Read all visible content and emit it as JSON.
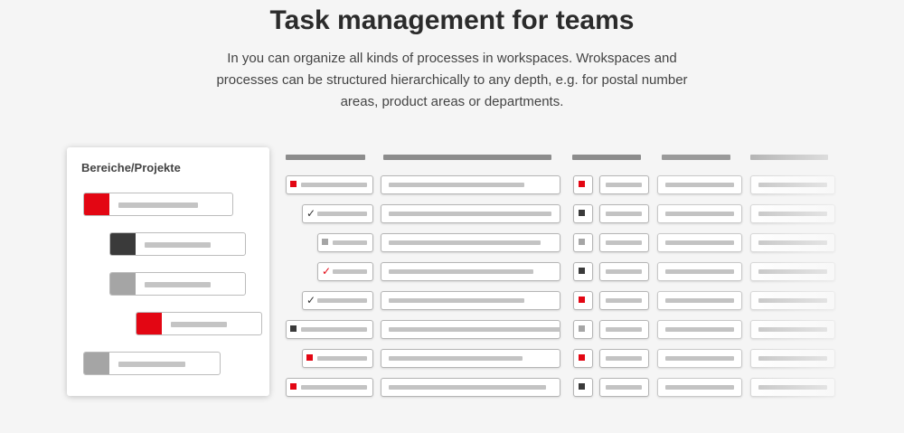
{
  "header": {
    "title": "Task management for teams",
    "subtitle": "In you can organize all kinds of processes in workspaces. Wrokspaces and processes can be structured hierarchically to any depth, e.g. for postal number areas, product areas or departments."
  },
  "colors": {
    "accent": "#e30613",
    "dark": "#3a3a3a",
    "gray": "#a5a5a5"
  },
  "tree_panel": {
    "title": "Bereiche/Projekte",
    "items": [
      {
        "level": 0,
        "color": "red"
      },
      {
        "level": 1,
        "color": "dark"
      },
      {
        "level": 1,
        "color": "gray"
      },
      {
        "level": 2,
        "color": "red"
      },
      {
        "level": 0,
        "color": "gray"
      }
    ]
  },
  "task_grid": {
    "rows": [
      {
        "indent": 0,
        "status_icon": "red-square-icon",
        "marker": "red"
      },
      {
        "indent": 1,
        "status_icon": "check-icon",
        "marker": "dark"
      },
      {
        "indent": 2,
        "status_icon": "gray-square-icon",
        "marker": "gray"
      },
      {
        "indent": 2,
        "status_icon": "red-check-icon",
        "marker": "dark"
      },
      {
        "indent": 1,
        "status_icon": "check-icon",
        "marker": "red"
      },
      {
        "indent": 0,
        "status_icon": "dark-square-icon",
        "marker": "gray"
      },
      {
        "indent": 1,
        "status_icon": "red-square-icon",
        "marker": "red"
      },
      {
        "indent": 0,
        "status_icon": "red-square-icon",
        "marker": "dark"
      }
    ]
  }
}
